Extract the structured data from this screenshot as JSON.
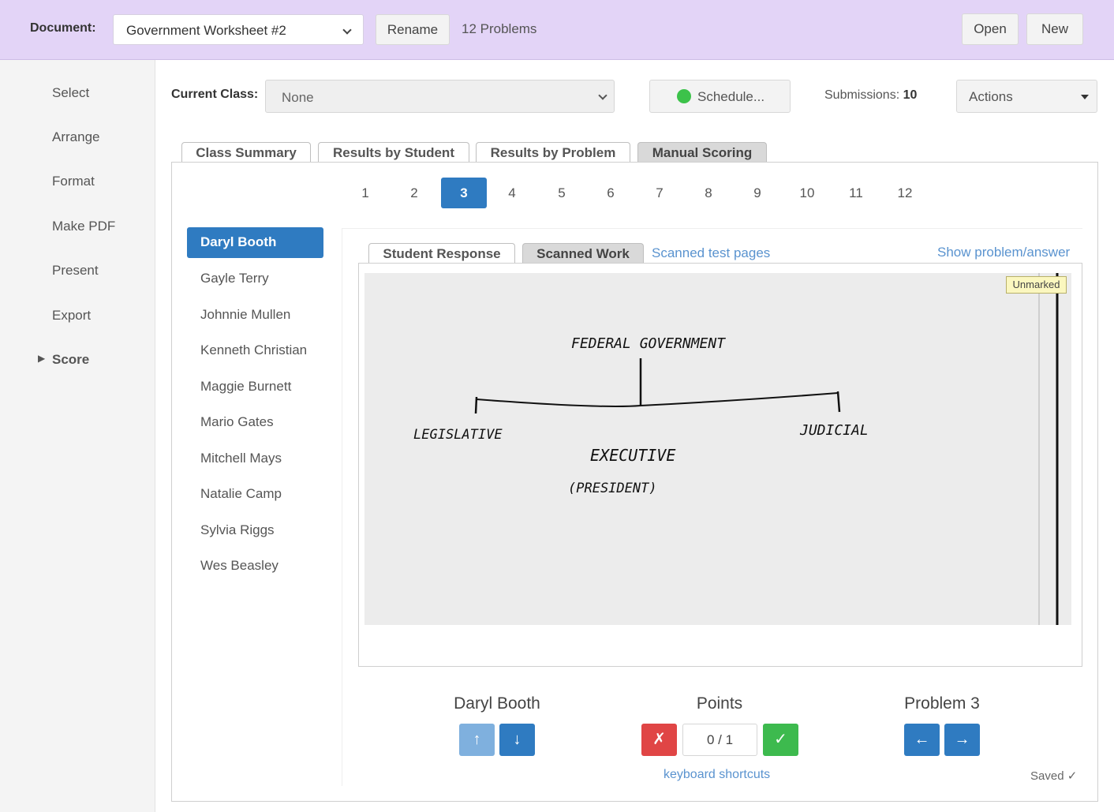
{
  "topbar": {
    "document_label": "Document:",
    "document_value": "Government Worksheet #2",
    "rename_label": "Rename",
    "problem_count": "12 Problems",
    "open_label": "Open",
    "new_label": "New"
  },
  "sidebar": {
    "items": [
      "Select",
      "Arrange",
      "Format",
      "Make PDF",
      "Present",
      "Export",
      "Score"
    ]
  },
  "class_bar": {
    "current_class_label": "Current Class:",
    "current_class_value": "None",
    "schedule_label": "Schedule...",
    "submissions_label": "Submissions:",
    "submissions_count": "10",
    "actions_label": "Actions"
  },
  "tabs": [
    "Class Summary",
    "Results by Student",
    "Results by Problem",
    "Manual Scoring"
  ],
  "problems": [
    "1",
    "2",
    "3",
    "4",
    "5",
    "6",
    "7",
    "8",
    "9",
    "10",
    "11",
    "12"
  ],
  "students": [
    "Daryl Booth",
    "Gayle Terry",
    "Johnnie Mullen",
    "Kenneth Christian",
    "Maggie Burnett",
    "Mario Gates",
    "Mitchell Mays",
    "Natalie Camp",
    "Sylvia Riggs",
    "Wes Beasley"
  ],
  "subtabs": {
    "student_response": "Student Response",
    "scanned_work": "Scanned Work",
    "scanned_pages_link": "Scanned test pages",
    "show_answer_link": "Show problem/answer"
  },
  "scan": {
    "status_badge": "Unmarked",
    "handwriting": {
      "root": "FEDERAL GOVERNMENT",
      "left": "LEGISLATIVE",
      "middle": "EXECUTIVE",
      "middle_sub": "(PRESIDENT)",
      "right": "JUDICIAL"
    }
  },
  "footer": {
    "student_name": "Daryl Booth",
    "points_label": "Points",
    "points_value": "0 / 1",
    "problem_label": "Problem 3",
    "keyboard_shortcuts": "keyboard shortcuts",
    "saved": "Saved"
  },
  "colors": {
    "topbar": "#e3d4f7",
    "accent": "#2f7bc1",
    "wrong": "#e04545",
    "correct": "#3dba4e",
    "schedule_dot": "#3cc24a"
  }
}
